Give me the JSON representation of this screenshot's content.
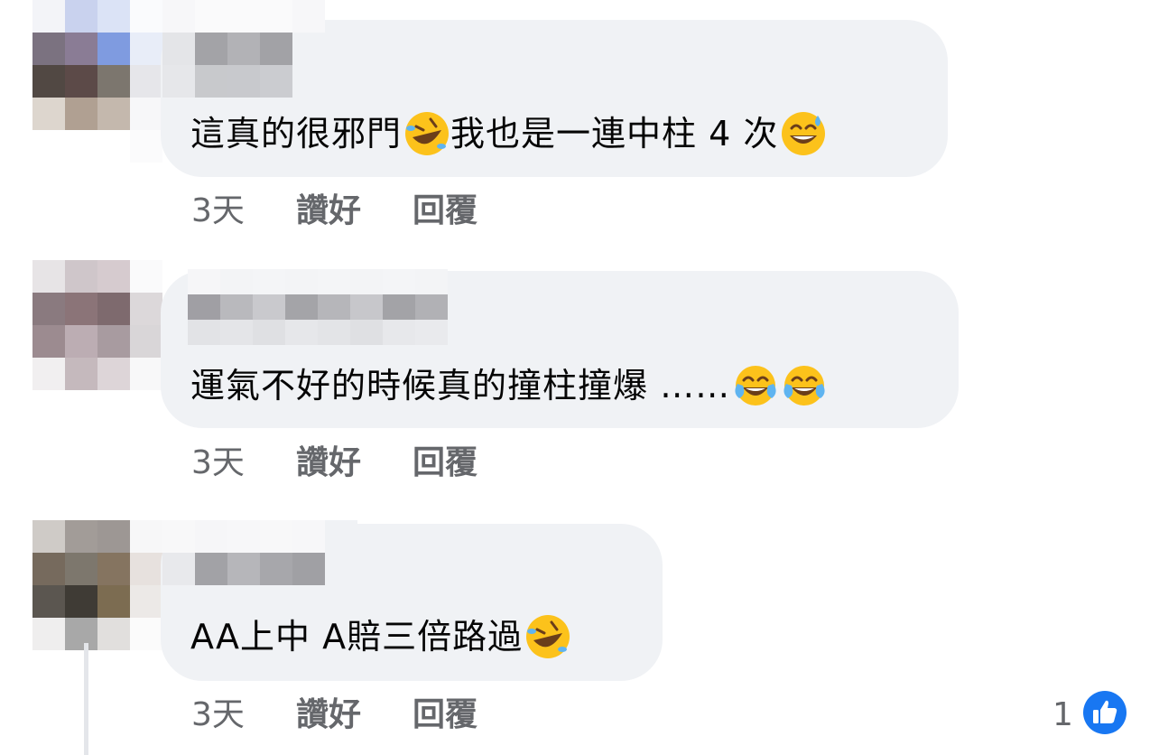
{
  "comments": [
    {
      "text": "這真的很邪門",
      "emoji1": "rolling-on-floor-laughing-emoji",
      "text2": "我也是一連中柱 4 次",
      "emoji2": "grinning-sweat-emoji",
      "time": "3天",
      "like_label": "讚好",
      "reply_label": "回覆"
    },
    {
      "text": "運氣不好的時候真的撞柱撞爆 ……",
      "emoji1": "tears-of-joy-emoji",
      "emoji2": "tears-of-joy-emoji",
      "time": "3天",
      "like_label": "讚好",
      "reply_label": "回覆"
    },
    {
      "text": "AA上中 A賠三倍路過",
      "emoji1": "rolling-on-floor-laughing-emoji",
      "time": "3天",
      "like_label": "讚好",
      "reply_label": "回覆",
      "reaction_count": "1",
      "reaction_icon": "thumbs-up-icon"
    }
  ],
  "colors": {
    "bubble": "#f0f2f5",
    "meta_text": "#65676b",
    "like_blue": "#1877f2"
  }
}
